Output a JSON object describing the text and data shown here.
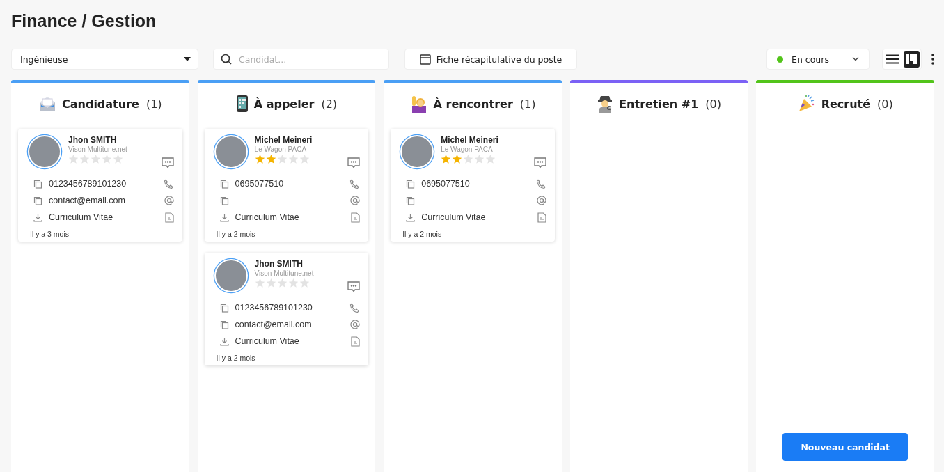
{
  "page": {
    "title": "Finance / Gestion"
  },
  "toolbar": {
    "company_select": {
      "value": "Ingénieuse"
    },
    "search": {
      "placeholder": "Candidat..."
    },
    "summary_button": "Fiche récapitulative du poste",
    "status_select": {
      "value": "En cours",
      "color": "#52c41a"
    },
    "views": [
      {
        "kind": "list",
        "selected": false
      },
      {
        "kind": "board",
        "selected": true
      }
    ]
  },
  "columns": [
    {
      "title": "Candidature",
      "count": "(1)",
      "color": "#4a9ff5",
      "cards": [
        {
          "name": "Jhon SMITH",
          "company": "Vison Multitune.net",
          "stars": 0,
          "phone": "0123456789101230",
          "email": "contact@email.com",
          "cv": "Curriculum Vitae",
          "age": "Il y a 3 mois"
        }
      ]
    },
    {
      "title": "À appeler",
      "count": "(2)",
      "color": "#4a9ff5",
      "cards": [
        {
          "name": "Michel Meineri",
          "company": "Le Wagon PACA",
          "stars": 2,
          "phone": "0695077510",
          "cv": "Curriculum Vitae",
          "age": "Il y a 2 mois"
        },
        {
          "name": "Jhon SMITH",
          "company": "Vison Multitune.net",
          "stars": 0,
          "phone": "0123456789101230",
          "email": "contact@email.com",
          "cv": "Curriculum Vitae",
          "age": "Il y a 2 mois"
        }
      ]
    },
    {
      "title": "À rencontrer",
      "count": "(1)",
      "color": "#4a9ff5",
      "cards": [
        {
          "name": "Michel Meineri",
          "company": "Le Wagon PACA",
          "stars": 2,
          "phone": "0695077510",
          "cv": "Curriculum Vitae",
          "age": "Il y a 2 mois"
        }
      ]
    },
    {
      "title": "Entretien #1",
      "count": "(0)",
      "color": "#7b61f5"
    },
    {
      "title": "Recruté",
      "count": "(0)",
      "color": "#52c41a"
    }
  ],
  "new_candidate_button": "Nouveau candidat"
}
